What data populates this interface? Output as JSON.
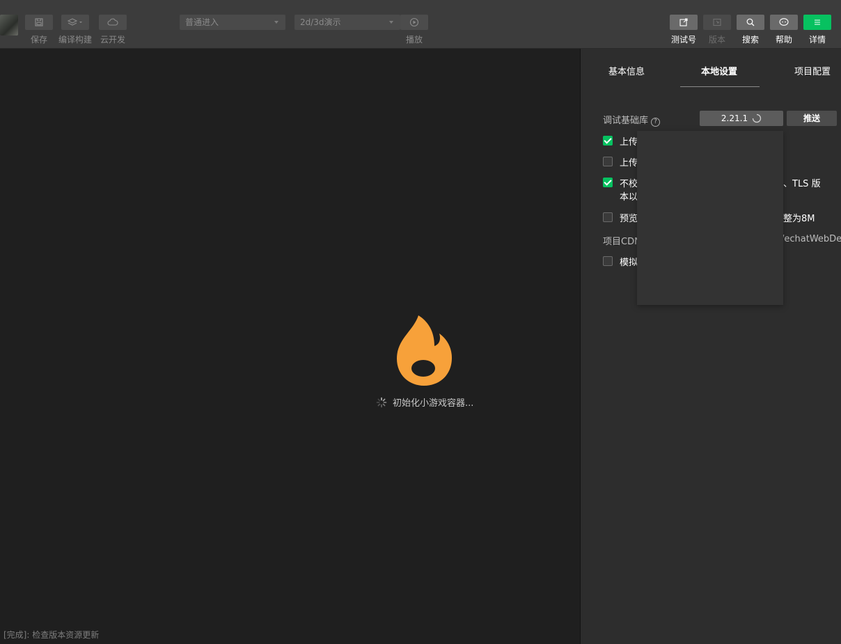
{
  "toolbar": {
    "save_label": "保存",
    "compile_label": "编译构建",
    "cloud_label": "云开发",
    "mode_select": "普通进入",
    "scene_select": "2d/3d演示",
    "play_label": "播放",
    "test_account_label": "测试号",
    "version_label": "版本",
    "search_label": "搜索",
    "help_label": "帮助",
    "details_label": "详情"
  },
  "simulator": {
    "loading_text": "初始化小游戏容器...",
    "status_text": "[完成]: 检查版本资源更新"
  },
  "panel": {
    "tabs": [
      {
        "label": "基本信息"
      },
      {
        "label": "本地设置"
      },
      {
        "label": "项目配置"
      }
    ],
    "debug_lib_label": "调试基础库",
    "help_icon": "?",
    "version": "2.21.1",
    "push_label": "推送",
    "opt1": "上传",
    "opt2": "上传",
    "opt3_line1": "不校",
    "opt3_tail": "、TLS 版",
    "opt3_line2": "本以",
    "opt4": "预览",
    "opt4_tail": "整为8M",
    "cdn_label": "项目CDN",
    "cdn_tail": "/echatWebDev/",
    "opt5": "模拟"
  },
  "colors": {
    "accent_green": "#07c160",
    "flame_orange": "#f7a13a"
  }
}
